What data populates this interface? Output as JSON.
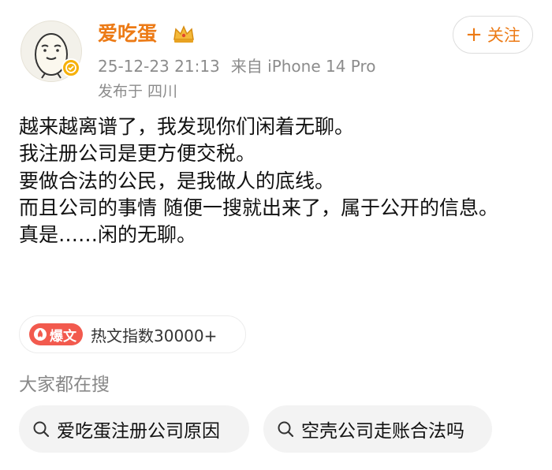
{
  "post": {
    "username": "爱吃蛋",
    "timestamp": "25-12-23 21:13",
    "source": "来自 iPhone 14 Pro",
    "location": "发布于 四川",
    "follow_label": "关注",
    "paragraphs": [
      "越来越离谱了，我发现你们闲着无聊。",
      "我注册公司是更方便交税。",
      "要做合法的公民，是我做人的底线。",
      "而且公司的事情 随便一搜就出来了，属于公开的信息。",
      "真是……闲的无聊。"
    ],
    "hot_badge": "爆文",
    "hot_text": "热文指数30000+"
  },
  "related_search": {
    "title": "大家都在搜",
    "items": [
      {
        "label": "爱吃蛋注册公司原因"
      },
      {
        "label": "空壳公司走账合法吗"
      }
    ]
  },
  "colors": {
    "username": "#ec7a15",
    "follow": "#ec7a15",
    "meta": "#8c8c8c",
    "hot_badge": "#f25a4e",
    "verified_badge": "#f6b10a",
    "chip_bg": "#f3f3f3"
  },
  "icons": {
    "avatar": "egg-cartoon-avatar",
    "verified": "verified-badge-icon",
    "crown": "crown-icon",
    "hot": "flame-icon",
    "search": "search-icon"
  }
}
